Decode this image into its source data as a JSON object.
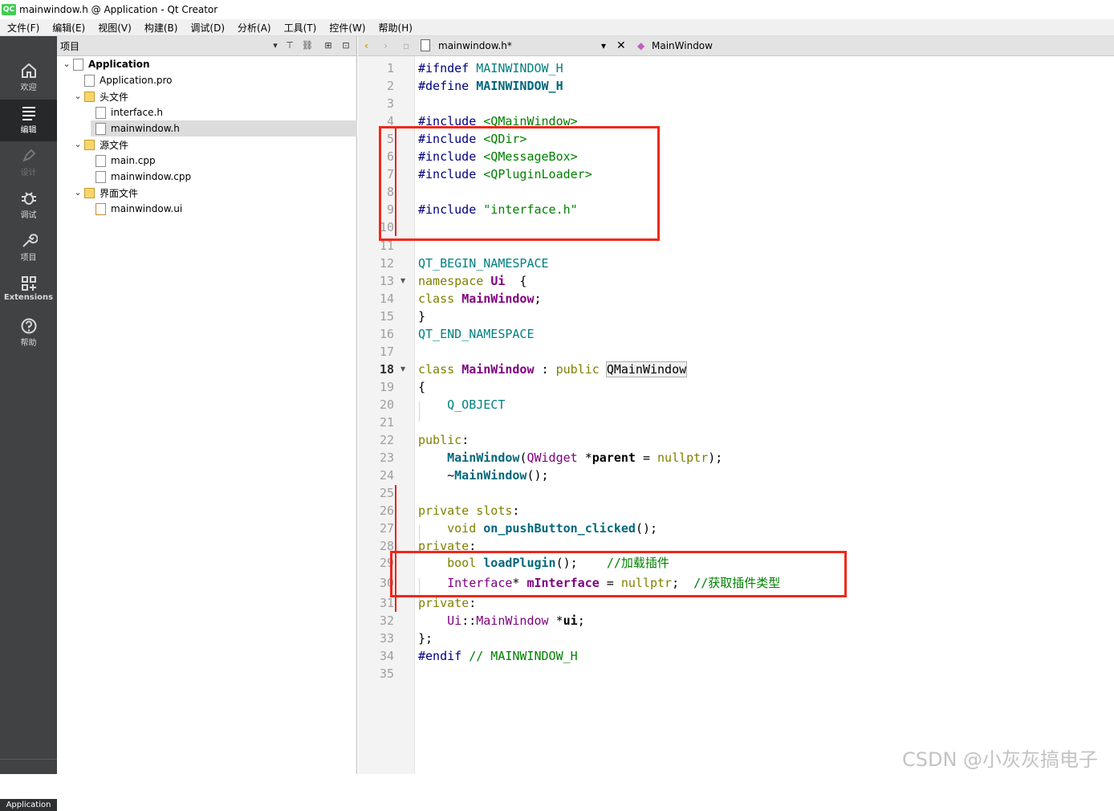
{
  "window": {
    "app_icon": "QC",
    "title": "mainwindow.h @ Application - Qt Creator"
  },
  "menu": [
    "文件(F)",
    "编辑(E)",
    "视图(V)",
    "构建(B)",
    "调试(D)",
    "分析(A)",
    "工具(T)",
    "控件(W)",
    "帮助(H)"
  ],
  "modes": [
    {
      "label": "欢迎",
      "icon": "home-icon"
    },
    {
      "label": "编辑",
      "icon": "edit-icon"
    },
    {
      "label": "设计",
      "icon": "design-pen-icon"
    },
    {
      "label": "调试",
      "icon": "bug-icon"
    },
    {
      "label": "项目",
      "icon": "wrench-icon"
    },
    {
      "label": "Extensions",
      "icon": "extensions-icon"
    },
    {
      "label": "帮助",
      "icon": "help-icon"
    }
  ],
  "bottom_project": "Application",
  "navigator": {
    "title": "项目",
    "tree": [
      {
        "label": "Application",
        "level": 0,
        "expanded": true,
        "type": "project"
      },
      {
        "label": "Application.pro",
        "level": 1,
        "type": "pro"
      },
      {
        "label": "头文件",
        "level": 1,
        "expanded": true,
        "type": "folder-h"
      },
      {
        "label": "interface.h",
        "level": 2,
        "type": "h"
      },
      {
        "label": "mainwindow.h",
        "level": 2,
        "type": "h",
        "selected": true
      },
      {
        "label": "源文件",
        "level": 1,
        "expanded": true,
        "type": "folder-cpp"
      },
      {
        "label": "main.cpp",
        "level": 2,
        "type": "cpp"
      },
      {
        "label": "mainwindow.cpp",
        "level": 2,
        "type": "cpp"
      },
      {
        "label": "界面文件",
        "level": 1,
        "expanded": true,
        "type": "folder-ui"
      },
      {
        "label": "mainwindow.ui",
        "level": 2,
        "type": "ui"
      }
    ]
  },
  "editor": {
    "file_tab": "mainwindow.h*",
    "symbol": "MainWindow",
    "current_line": 18
  },
  "code": {
    "line_count": 35,
    "lines": [
      {
        "n": 1,
        "seg": [
          [
            "pp",
            "#ifndef "
          ],
          [
            "m",
            "MAINWINDOW_H"
          ]
        ]
      },
      {
        "n": 2,
        "seg": [
          [
            "pp",
            "#define "
          ],
          [
            "bb",
            "MAINWINDOW_H"
          ]
        ]
      },
      {
        "n": 3,
        "seg": []
      },
      {
        "n": 4,
        "seg": [
          [
            "pp",
            "#include "
          ],
          [
            "s",
            "<QMainWindow>"
          ]
        ]
      },
      {
        "n": 5,
        "seg": [
          [
            "pp",
            "#include "
          ],
          [
            "s",
            "<QDir>"
          ]
        ]
      },
      {
        "n": 6,
        "seg": [
          [
            "pp",
            "#include "
          ],
          [
            "s",
            "<QMessageBox>"
          ]
        ]
      },
      {
        "n": 7,
        "seg": [
          [
            "pp",
            "#include "
          ],
          [
            "s",
            "<QPluginLoader>"
          ]
        ]
      },
      {
        "n": 8,
        "seg": []
      },
      {
        "n": 9,
        "seg": [
          [
            "pp",
            "#include "
          ],
          [
            "s",
            "\"interface.h\""
          ]
        ]
      },
      {
        "n": 10,
        "seg": []
      },
      {
        "n": 11,
        "seg": []
      },
      {
        "n": 12,
        "seg": [
          [
            "m",
            "QT_BEGIN_NAMESPACE"
          ]
        ]
      },
      {
        "n": 13,
        "seg": [
          [
            "k",
            "namespace "
          ],
          [
            "bm",
            "Ui"
          ],
          [
            "",
            "  {"
          ]
        ]
      },
      {
        "n": 14,
        "seg": [
          [
            "k",
            "class "
          ],
          [
            "bm",
            "MainWindow"
          ],
          [
            "",
            ";"
          ]
        ]
      },
      {
        "n": 15,
        "seg": [
          [
            "",
            "}"
          ]
        ]
      },
      {
        "n": 16,
        "seg": [
          [
            "m",
            "QT_END_NAMESPACE"
          ]
        ]
      },
      {
        "n": 17,
        "seg": []
      },
      {
        "n": 18,
        "seg": [
          [
            "k",
            "class "
          ],
          [
            "bm",
            "MainWindow"
          ],
          [
            "",
            " : "
          ],
          [
            "k",
            "public "
          ],
          [
            "hl",
            "QMainWindow"
          ]
        ]
      },
      {
        "n": 19,
        "seg": [
          [
            "",
            "{"
          ]
        ]
      },
      {
        "n": 20,
        "seg": [
          [
            "",
            "    "
          ],
          [
            "m",
            "Q_OBJECT"
          ]
        ]
      },
      {
        "n": 21,
        "seg": []
      },
      {
        "n": 22,
        "seg": [
          [
            "k",
            "public"
          ],
          [
            "",
            ":"
          ]
        ]
      },
      {
        "n": 23,
        "seg": [
          [
            "",
            "    "
          ],
          [
            "bb",
            "MainWindow"
          ],
          [
            "",
            "("
          ],
          [
            "t",
            "QWidget"
          ],
          [
            "",
            " *"
          ],
          [
            "bk",
            "parent"
          ],
          [
            "",
            " = "
          ],
          [
            "k",
            "nullptr"
          ],
          [
            "",
            ");"
          ]
        ]
      },
      {
        "n": 24,
        "seg": [
          [
            "",
            "    ~"
          ],
          [
            "bb",
            "MainWindow"
          ],
          [
            "",
            "();"
          ]
        ]
      },
      {
        "n": 25,
        "seg": []
      },
      {
        "n": 26,
        "seg": [
          [
            "k",
            "private slots"
          ],
          [
            "",
            ":"
          ]
        ]
      },
      {
        "n": 27,
        "seg": [
          [
            "",
            "    "
          ],
          [
            "k",
            "void "
          ],
          [
            "bb",
            "on_pushButton_clicked"
          ],
          [
            "",
            "();"
          ]
        ]
      },
      {
        "n": 28,
        "seg": [
          [
            "k",
            "private"
          ],
          [
            "",
            ":"
          ]
        ]
      },
      {
        "n": 29,
        "seg": [
          [
            "",
            "    "
          ],
          [
            "k",
            "bool "
          ],
          [
            "bb",
            "loadPlugin"
          ],
          [
            "",
            "();    "
          ],
          [
            "c",
            "//加载插件"
          ]
        ]
      },
      {
        "n": 30,
        "seg": [
          [
            "",
            "    "
          ],
          [
            "t",
            "Interface"
          ],
          [
            "",
            "* "
          ],
          [
            "bm",
            "mInterface"
          ],
          [
            "",
            " = "
          ],
          [
            "k",
            "nullptr"
          ],
          [
            "",
            ";  "
          ],
          [
            "c",
            "//获取插件类型"
          ]
        ]
      },
      {
        "n": 31,
        "seg": [
          [
            "k",
            "private"
          ],
          [
            "",
            ":"
          ]
        ]
      },
      {
        "n": 32,
        "seg": [
          [
            "",
            "    "
          ],
          [
            "t",
            "Ui"
          ],
          [
            "",
            "::"
          ],
          [
            "t",
            "MainWindow"
          ],
          [
            "",
            " *"
          ],
          [
            "bk",
            "ui"
          ],
          [
            "",
            ";"
          ]
        ]
      },
      {
        "n": 33,
        "seg": [
          [
            "",
            "};"
          ]
        ]
      },
      {
        "n": 34,
        "seg": [
          [
            "pp",
            "#endif "
          ],
          [
            "c",
            "// MAINWINDOW_H"
          ]
        ]
      },
      {
        "n": 35,
        "seg": []
      }
    ]
  },
  "watermark": "CSDN @小灰灰搞电子",
  "colors": {
    "annotation_red": "#f2271a",
    "sidebar_bg": "#404244",
    "qt_green": "#41cd52"
  }
}
